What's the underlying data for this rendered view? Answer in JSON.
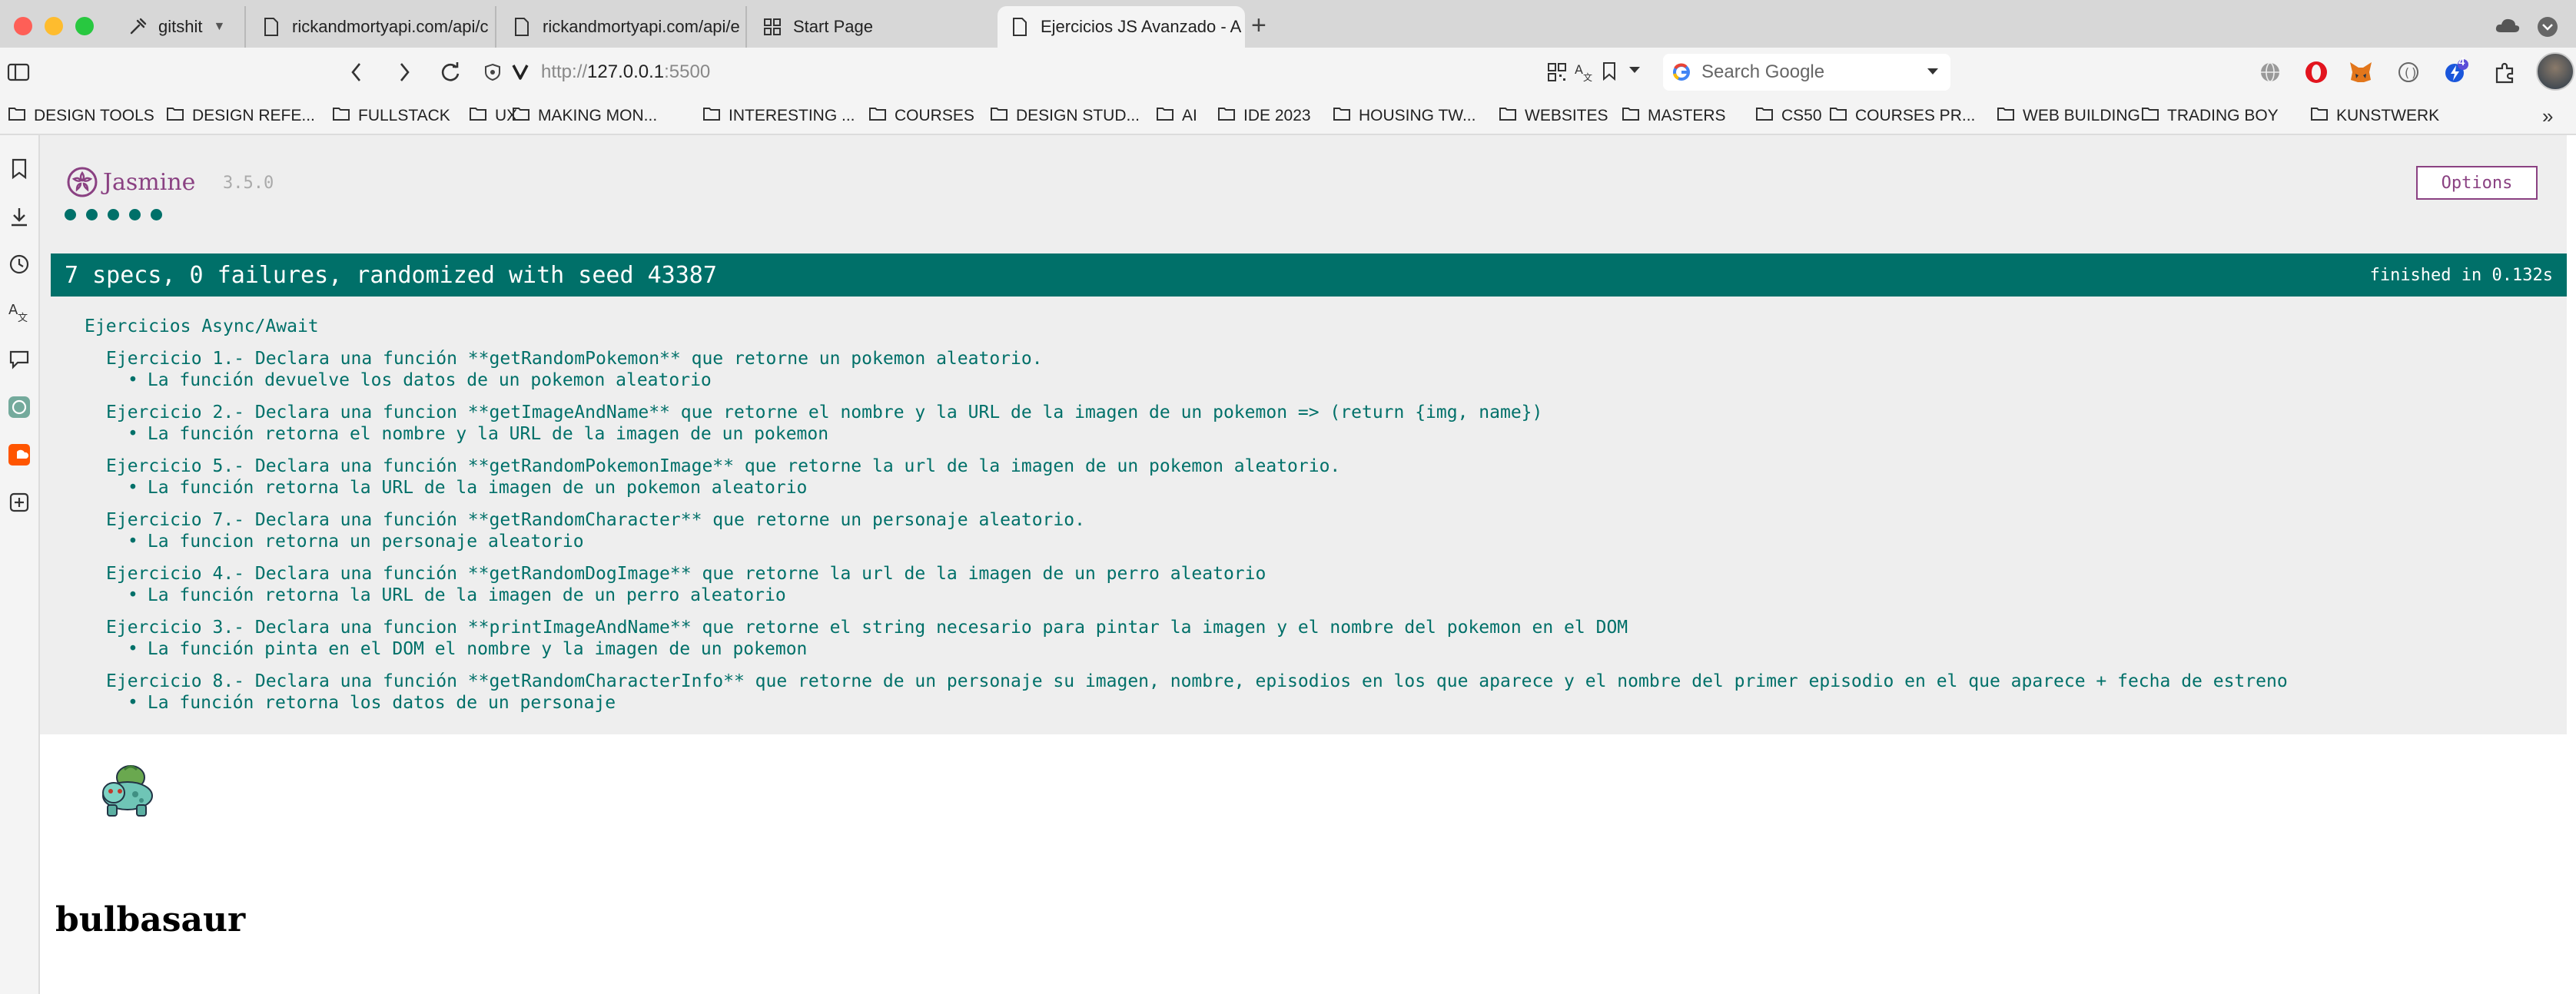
{
  "tabs": [
    {
      "label": "gitshit",
      "icon": "git-icon"
    },
    {
      "label": "rickandmortyapi.com/api/c",
      "icon": "page-icon"
    },
    {
      "label": "rickandmortyapi.com/api/e",
      "icon": "page-icon"
    },
    {
      "label": "Start Page",
      "icon": "grid-icon"
    },
    {
      "label": "Ejercicios JS Avanzado - A",
      "icon": "page-icon",
      "active": true
    }
  ],
  "address": {
    "url_prefix": "http://",
    "url_host": "127.0.0.1",
    "url_port": ":5500",
    "search_placeholder": "Search Google"
  },
  "extensions": {
    "notifications_badge": "4"
  },
  "bookmarks": [
    "DESIGN TOOLS",
    "DESIGN REFE...",
    "FULLSTACK",
    "UX",
    "MAKING MON...",
    "INTERESTING ...",
    "COURSES",
    "DESIGN STUD...",
    "AI",
    "IDE 2023",
    "HOUSING TW...",
    "WEBSITES",
    "MASTERS",
    "CS50",
    "COURSES PR...",
    "WEB BUILDING",
    "TRADING BOY",
    "KUNSTWERK"
  ],
  "jasmine": {
    "logo": "Jasmine",
    "version": "3.5.0",
    "options_label": "Options",
    "summary": "7 specs, 0 failures, randomized with seed 43387",
    "finished": "finished in 0.132s",
    "suite": "Ejercicios Async/Await",
    "specs": [
      {
        "title": "Ejercicio 1.- Declara una función **getRandomPokemon** que retorne un pokemon aleatorio.",
        "item": "La función devuelve los datos de un pokemon aleatorio"
      },
      {
        "title": "Ejercicio 2.- Declara una funcion **getImageAndName** que retorne el nombre y la URL de la imagen de un pokemon => (return {img, name})",
        "item": "La función retorna el nombre y la URL de la imagen de un pokemon"
      },
      {
        "title": "Ejercicio 5.- Declara una función **getRandomPokemonImage** que retorne la url de la imagen de un pokemon aleatorio.",
        "item": "La función retorna la URL de la imagen de un pokemon aleatorio"
      },
      {
        "title": "Ejercicio 7.- Declara una función **getRandomCharacter** que retorne un personaje aleatorio.",
        "item": "La funcion retorna un personaje aleatorio"
      },
      {
        "title": "Ejercicio 4.- Declara una función **getRandomDogImage** que retorne la url de la imagen de un perro aleatorio",
        "item": "La función retorna la URL de la imagen de un perro aleatorio"
      },
      {
        "title": "Ejercicio 3.- Declara una funcion **printImageAndName** que retorne el string necesario para pintar la imagen y el nombre del pokemon en el DOM",
        "item": "La función pinta en el DOM el nombre y la imagen de un pokemon"
      },
      {
        "title": "Ejercicio 8.- Declara una función **getRandomCharacterInfo** que retorne de un personaje su imagen, nombre, episodios en los que aparece y el nombre del primer episodio en el que aparece + fecha de estreno",
        "item": "La función retorna los datos de un personaje"
      }
    ]
  },
  "pokemon": {
    "name": "bulbasaur"
  }
}
